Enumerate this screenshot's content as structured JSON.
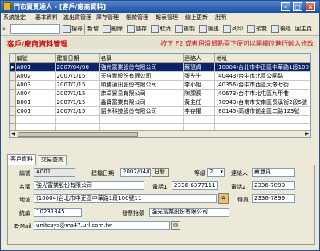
{
  "window": {
    "title": "門市買賣達人 - [客戶/廠商資料]"
  },
  "menu": [
    "系統設定",
    "基本資料",
    "進出貨管理",
    "庫存管理",
    "帳款管理",
    "報表管理",
    "線上更新",
    "說明"
  ],
  "toolbar": {
    "search_value": "",
    "search_label": "搜尋",
    "buttons": [
      "新增",
      "刪除",
      "儲存",
      "取消",
      "複製",
      "匯出",
      "列印",
      "預覽",
      "後退",
      "回主頁"
    ]
  },
  "header": {
    "title": "客戶/廠商資料管理",
    "hint": "按下 F2 或者用滑鼠點兩下便可以開欄位進行輸入修改"
  },
  "grid": {
    "columns": [
      "編號",
      "建檔日期",
      "名稱",
      "連絡人",
      "地址"
    ],
    "rows": [
      [
        "A001",
        "2007/04/06",
        "強光富業股份有限公司",
        "蘇慧貞",
        "(10004)台北市中正區中華路1段100"
      ],
      [
        "A002",
        "2007/1/15",
        "天祥資股份有限公司",
        "張先生",
        "(40443)台中市北區公園路"
      ],
      [
        "A003",
        "2007/1/15",
        "順勝通訊股份有限公司",
        "李小姐",
        "(40356)台中市西區大墩七街"
      ],
      [
        "A004",
        "2007/1/15",
        "弗卓貿易有限公司",
        "陳課長",
        "(40673)台中市北屯區九甲巷"
      ],
      [
        "B001",
        "2007/1/15",
        "鑫寶富業有限公司",
        "黃主任",
        "(70943)台南市安南區長溪街2段5號"
      ],
      [
        "C001",
        "2007/1/15",
        "貂卡科技股份有限公司",
        "李存權",
        "(80145)高雄市前金區二路123號"
      ]
    ],
    "selected_index": 0
  },
  "tabs": [
    "客戶資料",
    "交易查詢"
  ],
  "form": {
    "code_label": "編號",
    "code": "A001",
    "date_label": "建檔日期",
    "date": "2007/04/06",
    "calendar_label": "日曆",
    "level_label": "等級",
    "level": "2",
    "contact_label": "連絡人",
    "contact": "蘇慧貞",
    "name_label": "名稱",
    "name": "強光富業股份有限公司",
    "phone1_label": "電話1",
    "phone1": "2336-6377111",
    "phone2_label": "電話2",
    "phone2": "2336-7899",
    "address_label": "地址",
    "address": "(10004)台北市中正區中華路1段100號11",
    "fax_label": "傳真",
    "fax": "2336-7899",
    "taxid_label": "統編",
    "taxid": "10231345",
    "invoice_label": "發票抬頭",
    "invoice": "強光富業股份有限公司",
    "email_label": "E-Mail",
    "email": "unitesys@ms47.url.com.tw"
  }
}
